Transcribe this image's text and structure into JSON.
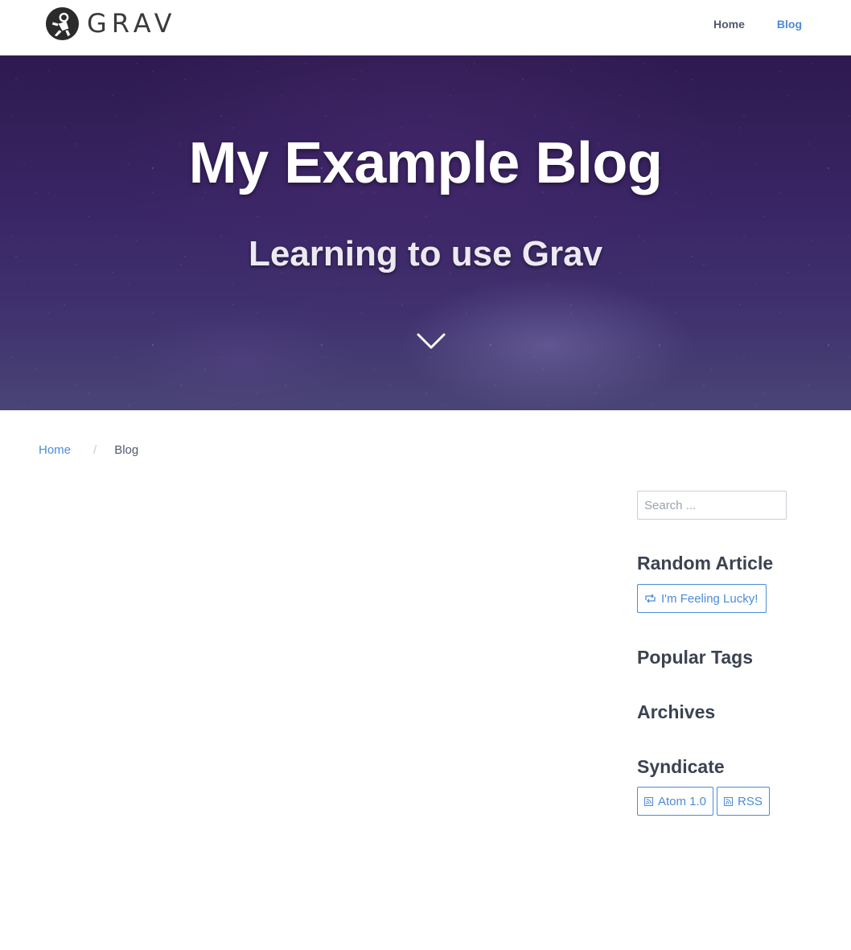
{
  "header": {
    "logo_text": "GRAV",
    "nav": [
      {
        "label": "Home",
        "active": false
      },
      {
        "label": "Blog",
        "active": true
      }
    ]
  },
  "hero": {
    "title": "My Example Blog",
    "subtitle": "Learning to use Grav",
    "scroll_icon": "chevron-down-icon"
  },
  "breadcrumb": {
    "items": [
      "Home",
      "Blog"
    ],
    "separator": "/"
  },
  "sidebar": {
    "search": {
      "placeholder": "Search ...",
      "value": ""
    },
    "random_heading": "Random Article",
    "lucky_button": "I'm Feeling Lucky!",
    "tags_heading": "Popular Tags",
    "archives_heading": "Archives",
    "syndicate_heading": "Syndicate",
    "feeds": [
      "Atom 1.0",
      "RSS"
    ]
  },
  "colors": {
    "accent": "#4b8bd8",
    "text": "#3b4351",
    "hero_top": "#2e1a4f",
    "hero_bottom": "#4a4576"
  }
}
